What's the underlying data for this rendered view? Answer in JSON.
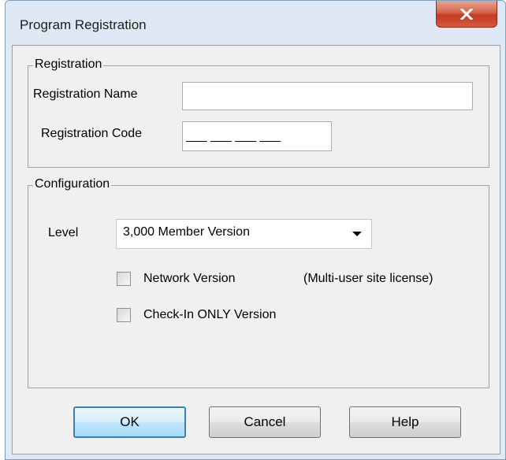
{
  "window": {
    "title": "Program Registration"
  },
  "registration": {
    "group_label": "Registration",
    "name_label": "Registration Name",
    "name_value": "",
    "code_label": "Registration Code",
    "code_value": "___ ___ ___ ___"
  },
  "configuration": {
    "group_label": "Configuration",
    "level_label": "Level",
    "level_value": "3,000 Member Version",
    "network_label": "Network Version",
    "network_note": "(Multi-user site license)",
    "network_checked": false,
    "checkin_label": "Check-In ONLY Version",
    "checkin_checked": false
  },
  "buttons": {
    "ok": "OK",
    "cancel": "Cancel",
    "help": "Help"
  },
  "icons": {
    "close": "close-icon",
    "dropdown": "dropdown-arrow-icon"
  },
  "colors": {
    "close_button": "#c7391f",
    "default_button_border": "#3c7fb1",
    "window_frame": "#dfe9f5",
    "dialog_background": "#f0f0f0"
  }
}
